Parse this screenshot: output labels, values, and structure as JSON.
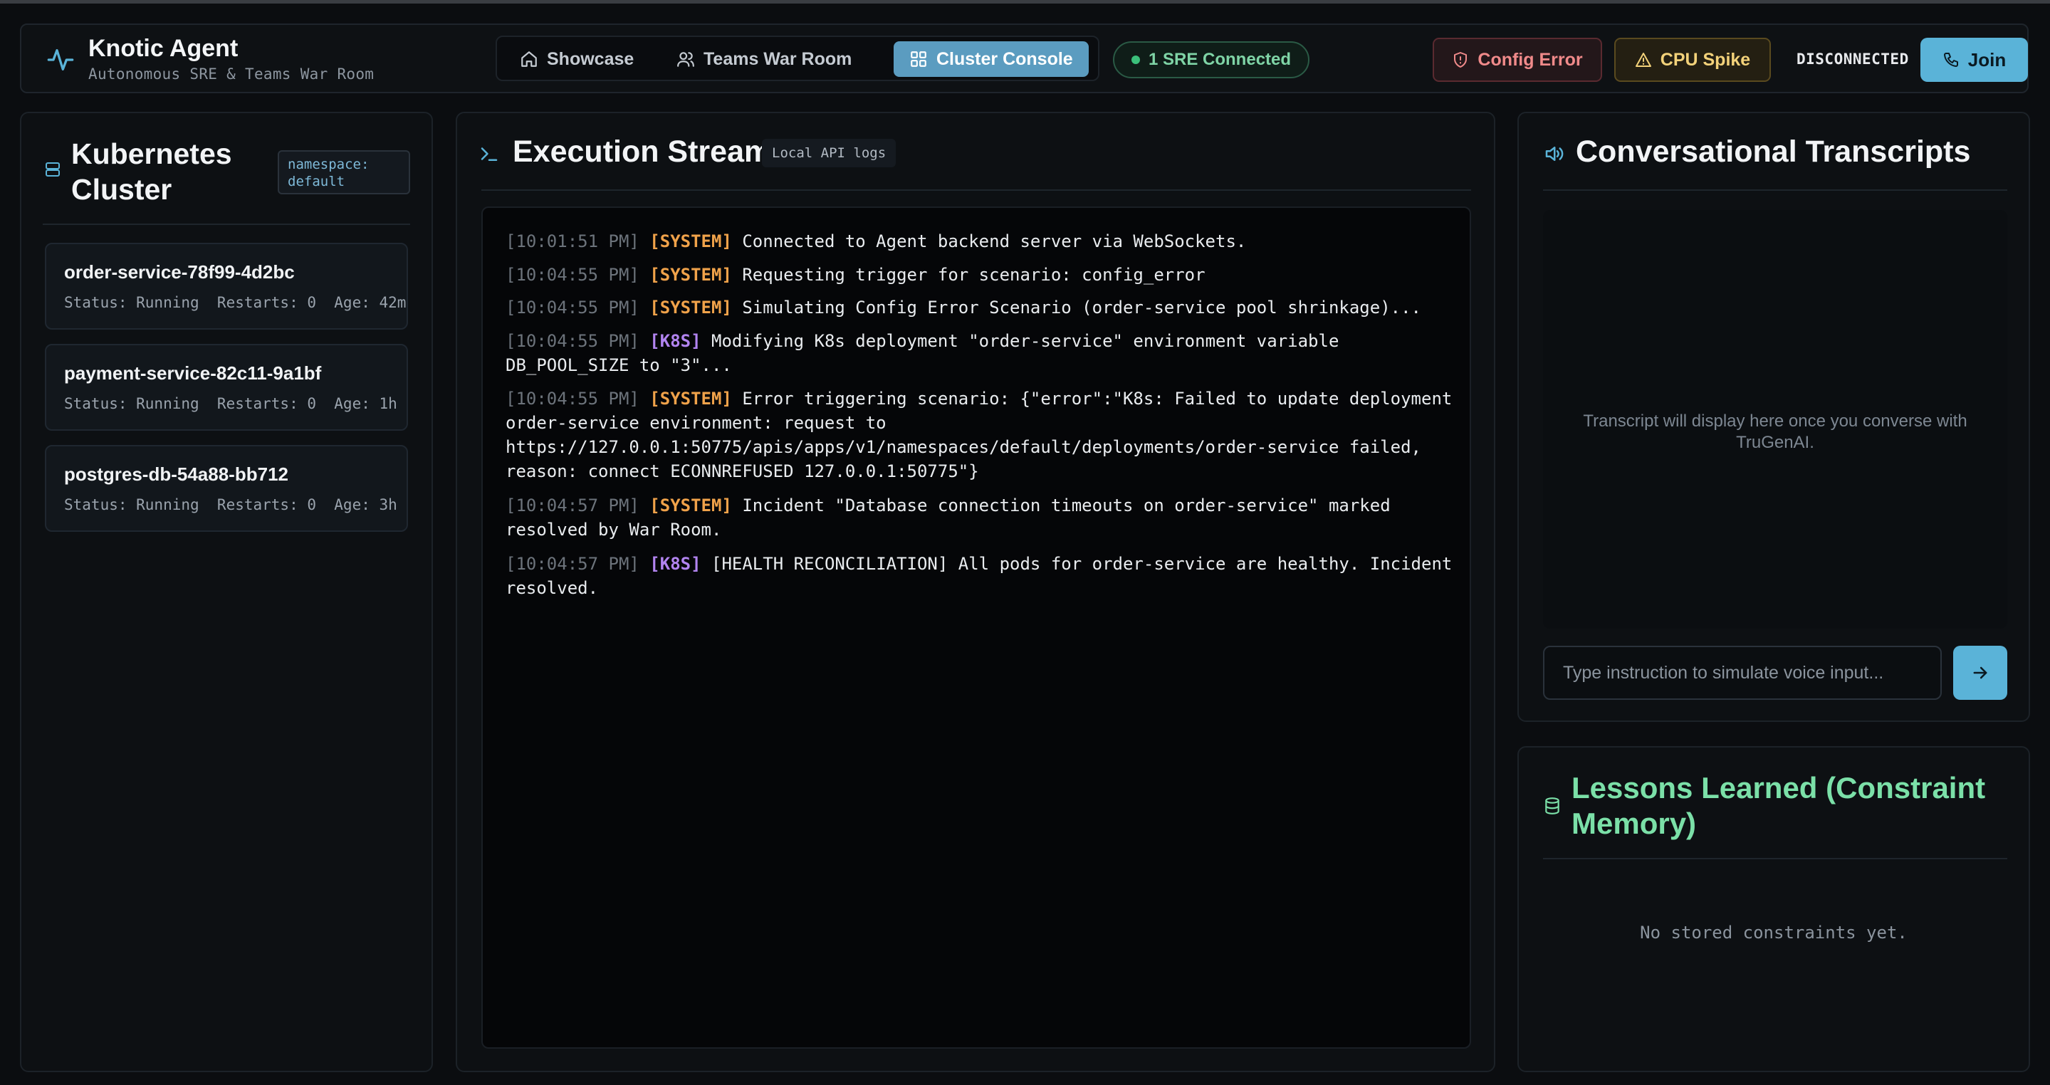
{
  "app": {
    "title": "Knotic Agent",
    "subtitle": "Autonomous SRE & Teams War Room"
  },
  "nav": {
    "showcase": "Showcase",
    "war_room": "Teams War Room",
    "cluster_console": "Cluster Console",
    "active_tab": "Cluster Console"
  },
  "status": {
    "sre_connected": "1 SRE Connected",
    "connection": "DISCONNECTED"
  },
  "actions": {
    "config_error": "Config Error",
    "cpu_spike": "CPU Spike",
    "join": "Join"
  },
  "cluster": {
    "title": "Kubernetes Cluster",
    "namespace_badge": "namespace: default",
    "pods": [
      {
        "name": "order-service-78f99-4d2bc",
        "status": "Running",
        "restarts": "0",
        "age": "42m",
        "meta": "Status: Running  Restarts: 0  Age: 42m"
      },
      {
        "name": "payment-service-82c11-9a1bf",
        "status": "Running",
        "restarts": "0",
        "age": "1h",
        "meta": "Status: Running  Restarts: 0  Age: 1h"
      },
      {
        "name": "postgres-db-54a88-bb712",
        "status": "Running",
        "restarts": "0",
        "age": "3h",
        "meta": "Status: Running  Restarts: 0  Age: 3h"
      }
    ]
  },
  "stream": {
    "title": "Execution Stream",
    "badge": "Local API logs",
    "logs": [
      {
        "time": "[10:01:51 PM]",
        "tag": "[SYSTEM]",
        "msg": "Connected to Agent backend server via WebSockets."
      },
      {
        "time": "[10:04:55 PM]",
        "tag": "[SYSTEM]",
        "msg": "Requesting trigger for scenario: config_error"
      },
      {
        "time": "[10:04:55 PM]",
        "tag": "[SYSTEM]",
        "msg": "Simulating Config Error Scenario (order-service pool shrinkage)..."
      },
      {
        "time": "[10:04:55 PM]",
        "tag": "[K8S]",
        "msg": "Modifying K8s deployment \"order-service\" environment variable DB_POOL_SIZE to \"3\"..."
      },
      {
        "time": "[10:04:55 PM]",
        "tag": "[SYSTEM]",
        "msg": "Error triggering scenario: {\"error\":\"K8s: Failed to update deployment order-service environment: request to https://127.0.0.1:50775/apis/apps/v1/namespaces/default/deployments/order-service failed, reason: connect ECONNREFUSED 127.0.0.1:50775\"}"
      },
      {
        "time": "[10:04:57 PM]",
        "tag": "[SYSTEM]",
        "msg": "Incident \"Database connection timeouts on order-service\" marked resolved by War Room."
      },
      {
        "time": "[10:04:57 PM]",
        "tag": "[K8S]",
        "msg": "[HEALTH RECONCILIATION] All pods for order-service are healthy. Incident resolved."
      }
    ]
  },
  "transcripts": {
    "title": "Conversational Transcripts",
    "empty": "Transcript will display here once you converse with TruGenAI.",
    "input_placeholder": "Type instruction to simulate voice input...",
    "input_value": ""
  },
  "lessons": {
    "title": "Lessons Learned (Constraint Memory)",
    "empty": "No stored constraints yet."
  },
  "colors": {
    "accent": "#5ab3d8",
    "active_tab": "#5b9cc0",
    "system_tag": "#f0a24a",
    "k8s_tag": "#b284f0",
    "lessons_title": "#7be0a8",
    "connected": "#3bbf7a"
  },
  "icons": {
    "brand": "pulse-icon",
    "showcase": "home-icon",
    "war_room": "users-icon",
    "cluster_console": "grid-icon",
    "config_error": "shield-icon",
    "cpu_spike": "alert-triangle-icon",
    "join": "phone-icon",
    "cluster": "server-icon",
    "stream": "terminal-icon",
    "transcripts": "speaker-icon",
    "send": "arrow-right-icon",
    "lessons": "database-icon"
  }
}
